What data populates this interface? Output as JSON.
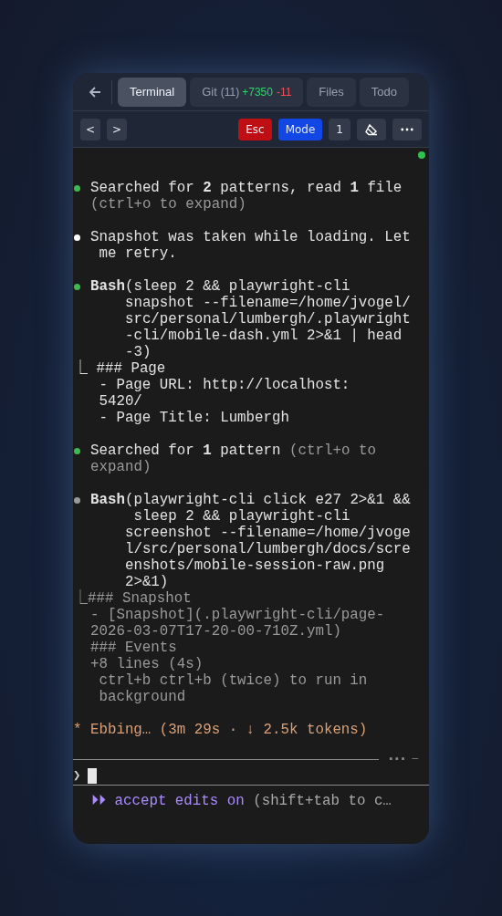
{
  "tabs": [
    {
      "label": "Terminal",
      "selected": true
    },
    {
      "label": "Git",
      "count": "(11)",
      "added": "+7350",
      "removed": "-11",
      "selected": false
    },
    {
      "label": "Files",
      "selected": false
    },
    {
      "label": "Todo",
      "selected": false
    }
  ],
  "toolbar": {
    "prev": "<",
    "next": ">",
    "esc": "Esc",
    "mode": "Mode",
    "count": "1"
  },
  "connected": true,
  "entries": [
    {
      "color": "#3fb950",
      "lines": [
        [
          {
            "text": "Searched for **2** patterns, read **1** file",
            "dim": false
          }
        ],
        [
          {
            "text": "(ctrl+o to expand)",
            "dim": true
          }
        ]
      ]
    },
    {
      "color": "#ffffff",
      "lines": [
        [
          {
            "text": "Snapshot was taken while loading. Let",
            "dim": false
          }
        ],
        [
          {
            "text": " me retry.",
            "dim": false
          }
        ]
      ]
    },
    {
      "color": "#3fb950",
      "lines": [
        [
          {
            "text": "**Bash**(sleep 2 && playwright-cli",
            "dim": false
          }
        ],
        [
          {
            "text": "    snapshot --filename=/home/jvogel/",
            "dim": false
          }
        ],
        [
          {
            "text": "    src/personal/lumbergh/.playwright",
            "dim": false
          }
        ],
        [
          {
            "text": "    -cli/mobile-dash.yml 2>&1 | head",
            "dim": false
          }
        ],
        [
          {
            "text": "    -3)",
            "dim": false
          }
        ]
      ],
      "output": [
        [
          {
            "text": "⎿ ### Page",
            "dim": false
          }
        ],
        [
          {
            "text": "   - Page URL: http://localhost:",
            "dim": false
          }
        ],
        [
          {
            "text": "   5420/",
            "dim": false
          }
        ],
        [
          {
            "text": "   - Page Title: Lumbergh",
            "dim": false
          }
        ]
      ]
    },
    {
      "color": "#3fb950",
      "lines": [
        [
          {
            "text": "Searched for **1** pattern ",
            "dim": false
          },
          {
            "text": "(ctrl+o to",
            "dim": true
          }
        ],
        [
          {
            "text": "expand)",
            "dim": true
          }
        ]
      ]
    },
    {
      "color": "#9a9a9a",
      "lines": [
        [
          {
            "text": "**Bash**(playwright-cli click e27 2>&1 &&",
            "dim": false
          }
        ],
        [
          {
            "text": "     sleep 2 && playwright-cli",
            "dim": false
          }
        ],
        [
          {
            "text": "    screenshot --filename=/home/jvoge",
            "dim": false
          }
        ],
        [
          {
            "text": "    l/src/personal/lumbergh/docs/scre",
            "dim": false
          }
        ],
        [
          {
            "text": "    enshots/mobile-session-raw.png",
            "dim": false
          }
        ],
        [
          {
            "text": "    2>&1)",
            "dim": false
          }
        ]
      ],
      "output": [
        [
          {
            "text": "⎿### Snapshot",
            "dim": true
          }
        ],
        [
          {
            "text": "  - [Snapshot](.playwright-cli/page-",
            "dim": true
          }
        ],
        [
          {
            "text": "  2026-03-07T17-20-00-710Z.yml)",
            "dim": true
          }
        ],
        [
          {
            "text": "  ### Events",
            "dim": true
          }
        ],
        [
          {
            "text": "  +8 lines (4s)",
            "dim": true
          }
        ],
        [
          {
            "text": "   ctrl+b ctrl+b (twice) to run in",
            "dim": true
          }
        ],
        [
          {
            "text": "   background",
            "dim": true
          }
        ]
      ]
    }
  ],
  "status": {
    "star": "*",
    "text": "Ebbing… (3m 29s · ↓ 2.5k tokens)"
  },
  "divider_marks": "▪▪▪ ─",
  "prompt": {
    "symbol": "❯"
  },
  "mode": {
    "arrows": "⏵⏵",
    "label": "accept edits on",
    "hint": "(shift+tab to c…"
  }
}
